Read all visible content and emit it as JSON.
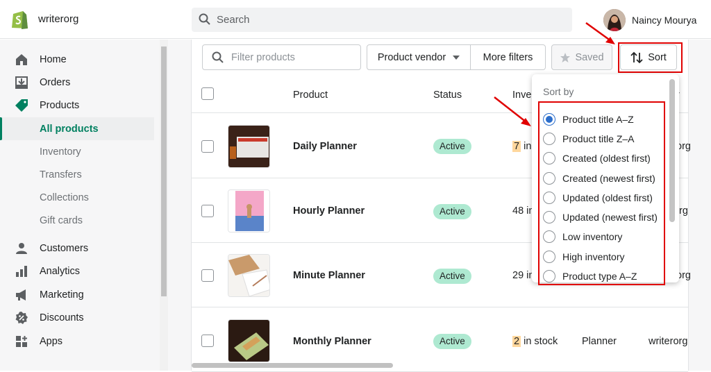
{
  "topbar": {
    "store_name": "writerorg",
    "search_placeholder": "Search",
    "user_name": "Naincy Mourya"
  },
  "sidebar": {
    "items": [
      {
        "label": "Home",
        "icon": "home-icon"
      },
      {
        "label": "Orders",
        "icon": "orders-icon"
      },
      {
        "label": "Products",
        "icon": "tag-icon"
      },
      {
        "label": "All products"
      },
      {
        "label": "Inventory"
      },
      {
        "label": "Transfers"
      },
      {
        "label": "Collections"
      },
      {
        "label": "Gift cards"
      },
      {
        "label": "Customers",
        "icon": "person-icon"
      },
      {
        "label": "Analytics",
        "icon": "analytics-icon"
      },
      {
        "label": "Marketing",
        "icon": "megaphone-icon"
      },
      {
        "label": "Discounts",
        "icon": "discount-icon"
      },
      {
        "label": "Apps",
        "icon": "apps-icon"
      }
    ]
  },
  "toolbar": {
    "filter_placeholder": "Filter products",
    "vendor_label": "Product vendor",
    "more_filters_label": "More filters",
    "saved_label": "Saved",
    "sort_label": "Sort"
  },
  "table": {
    "headers": {
      "product": "Product",
      "status": "Status",
      "inventory": "Inve",
      "vendor_partial": "r"
    },
    "rows": [
      {
        "name": "Daily Planner",
        "status": "Active",
        "inv_num": "7",
        "inv_text": " in",
        "type": "",
        "vendor": "org"
      },
      {
        "name": "Hourly Planner",
        "status": "Active",
        "inv_num": "",
        "inv_text": "48 in",
        "type": "",
        "vendor": "rg"
      },
      {
        "name": "Minute Planner",
        "status": "Active",
        "inv_num": "",
        "inv_text": "29 in",
        "type": "",
        "vendor": "org"
      },
      {
        "name": "Monthly Planner",
        "status": "Active",
        "inv_num": "2",
        "inv_text": " in stock",
        "type": "Planner",
        "vendor": "writerorg"
      }
    ]
  },
  "sort_menu": {
    "header": "Sort by",
    "options": [
      "Product title A–Z",
      "Product title Z–A",
      "Created (oldest first)",
      "Created (newest first)",
      "Updated (oldest first)",
      "Updated (newest first)",
      "Low inventory",
      "High inventory",
      "Product type A–Z"
    ],
    "selected_index": 0
  },
  "colors": {
    "accent": "#008060",
    "annotation_red": "#e00000",
    "radio_blue": "#2c6ecb",
    "badge_green": "#aee9d1"
  }
}
